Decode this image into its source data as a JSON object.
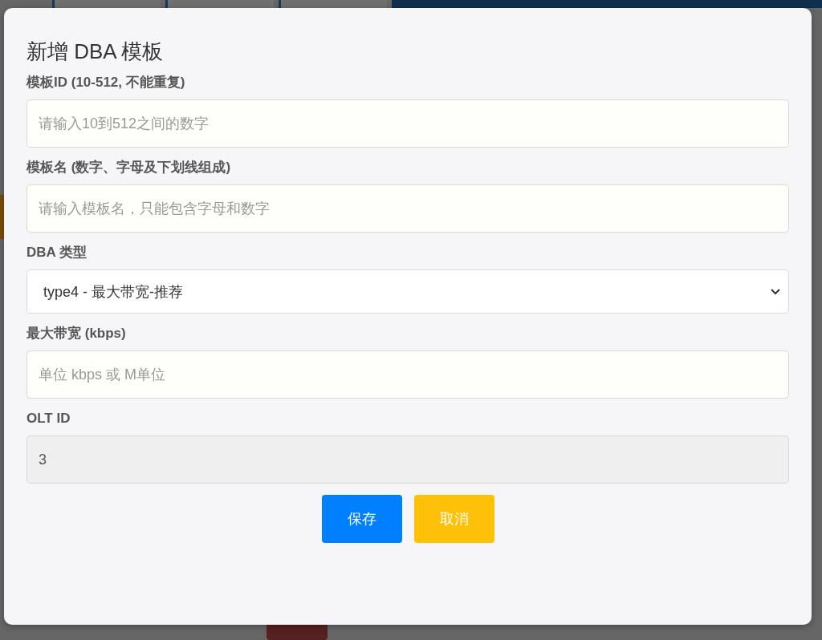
{
  "dialog": {
    "title": "新增 DBA 模板",
    "fields": [
      {
        "kind": "text",
        "label": "模板ID (10-512, 不能重复)",
        "placeholder": "请输入10到512之间的数字"
      },
      {
        "kind": "text",
        "label": "模板名 (数字、字母及下划线组成)",
        "placeholder": "请输入模板名，只能包含字母和数字"
      },
      {
        "kind": "select",
        "label": "DBA 类型",
        "value": "type4 - 最大带宽-推荐"
      },
      {
        "kind": "text",
        "label": "最大带宽 (kbps)",
        "placeholder": "单位 kbps 或 M单位"
      },
      {
        "kind": "text",
        "label": "OLT ID",
        "value": "3",
        "disabled": true
      }
    ],
    "buttons": [
      {
        "kind": "primary",
        "label": "保存"
      },
      {
        "kind": "warning",
        "label": "取消"
      }
    ]
  }
}
